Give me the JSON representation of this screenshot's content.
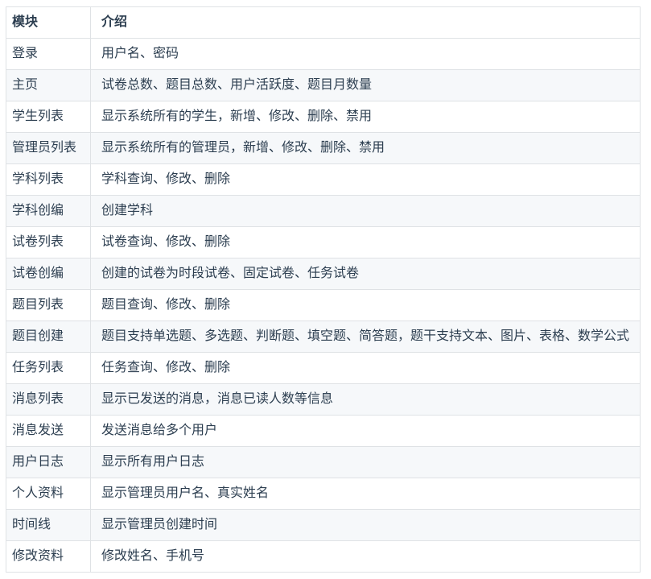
{
  "colors": {
    "text": "#2c3e50",
    "border": "#dfe2e5",
    "stripe": "#f6f8fa",
    "page_background": "#ffffff"
  },
  "table": {
    "columns": [
      "模块",
      "介绍"
    ],
    "rows": [
      {
        "module": "登录",
        "intro": "用户名、密码"
      },
      {
        "module": "主页",
        "intro": "试卷总数、题目总数、用户活跃度、题目月数量"
      },
      {
        "module": "学生列表",
        "intro": "显示系统所有的学生，新增、修改、删除、禁用"
      },
      {
        "module": "管理员列表",
        "intro": "显示系统所有的管理员，新增、修改、删除、禁用"
      },
      {
        "module": "学科列表",
        "intro": "学科查询、修改、删除"
      },
      {
        "module": "学科创编",
        "intro": "创建学科"
      },
      {
        "module": "试卷列表",
        "intro": "试卷查询、修改、删除"
      },
      {
        "module": "试卷创编",
        "intro": "创建的试卷为时段试卷、固定试卷、任务试卷"
      },
      {
        "module": "题目列表",
        "intro": "题目查询、修改、删除"
      },
      {
        "module": "题目创建",
        "intro": "题目支持单选题、多选题、判断题、填空题、简答题，题干支持文本、图片、表格、数学公式"
      },
      {
        "module": "任务列表",
        "intro": "任务查询、修改、删除"
      },
      {
        "module": "消息列表",
        "intro": "显示已发送的消息，消息已读人数等信息"
      },
      {
        "module": "消息发送",
        "intro": "发送消息给多个用户"
      },
      {
        "module": "用户日志",
        "intro": "显示所有用户日志"
      },
      {
        "module": "个人资料",
        "intro": "显示管理员用户名、真实姓名"
      },
      {
        "module": "时间线",
        "intro": "显示管理员创建时间"
      },
      {
        "module": "修改资料",
        "intro": "修改姓名、手机号"
      }
    ]
  }
}
